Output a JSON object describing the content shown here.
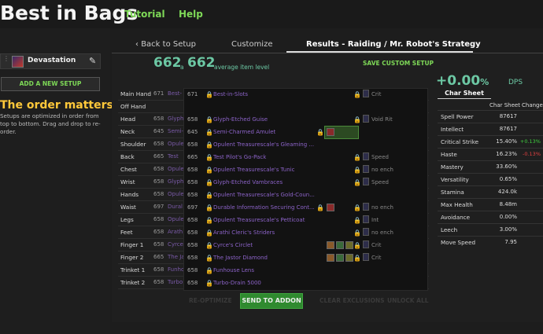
{
  "app": {
    "logo": "Best in Bags",
    "nav": [
      "Tutorial",
      "Help"
    ]
  },
  "sidebar": {
    "setup_name": "Devastation",
    "add_setup": "ADD A NEW SETUP",
    "order_title": "The order matters",
    "order_text": "Setups are optimized in order from top to bottom. Drag and drop to re-order."
  },
  "tabs": {
    "back": "Back to Setup",
    "customize": "Customize",
    "results": "Results - Raiding / Mr. Robot's Strategy"
  },
  "summary": {
    "ilvl_a": "662",
    "ilvl_a_label": "a",
    "ilvl_b": "662",
    "ilvl_b_label": "average item level",
    "save_custom": "SAVE CUSTOM SETUP",
    "dps_change": "+0.00",
    "dps_pct": "%",
    "dps_label": "DPS"
  },
  "char_sheet": {
    "tab": "Char Sheet",
    "col_sheet": "Char Sheet",
    "col_change": "Change",
    "stats": [
      {
        "name": "Spell Power",
        "value": "87617",
        "change": ""
      },
      {
        "name": "Intellect",
        "value": "87617",
        "change": ""
      },
      {
        "name": "Critical Strike",
        "value": "15.40%",
        "change": "+0.13%"
      },
      {
        "name": "Haste",
        "value": "16.23%",
        "change": "-0.13%"
      },
      {
        "name": "Mastery",
        "value": "33.60%",
        "change": ""
      },
      {
        "name": "Versatility",
        "value": "0.65%",
        "change": ""
      },
      {
        "name": "Stamina",
        "value": "424.0k",
        "change": ""
      },
      {
        "name": "Max Health",
        "value": "8.48m",
        "change": ""
      },
      {
        "name": "Avoidance",
        "value": "0.00%",
        "change": ""
      },
      {
        "name": "Leech",
        "value": "3.00%",
        "change": ""
      },
      {
        "name": "Move Speed",
        "value": "7.95",
        "change": ""
      }
    ],
    "colors": {
      "positive": "#3fcf3f",
      "negative": "#e04040"
    }
  },
  "gear": [
    {
      "slot": "Main Hand",
      "ilvl": "671",
      "item": "Best-",
      "ov_ilvl": "671",
      "ov_item": "Best-in-Slots",
      "extra": "Crit"
    },
    {
      "slot": "Off Hand",
      "ilvl": "",
      "item": "",
      "ov_ilvl": "",
      "ov_item": "",
      "extra": ""
    },
    {
      "slot": "Head",
      "ilvl": "658",
      "item": "Glyph",
      "ov_ilvl": "658",
      "ov_item": "Glyph-Etched Guise",
      "extra": "Void Rit"
    },
    {
      "slot": "Neck",
      "ilvl": "645",
      "item": "Semi-",
      "ov_ilvl": "645",
      "ov_item": "Semi-Charmed Amulet",
      "extra": ""
    },
    {
      "slot": "Shoulder",
      "ilvl": "658",
      "item": "Opule",
      "ov_ilvl": "658",
      "ov_item": "Opulent Treasurescale's Gleaming ...",
      "extra": ""
    },
    {
      "slot": "Back",
      "ilvl": "665",
      "item": "Test",
      "ov_ilvl": "665",
      "ov_item": "Test Pilot's Go-Pack",
      "extra": "Speed"
    },
    {
      "slot": "Chest",
      "ilvl": "658",
      "item": "Opule",
      "ov_ilvl": "658",
      "ov_item": "Opulent Treasurescale's Tunic",
      "extra": "no ench"
    },
    {
      "slot": "Wrist",
      "ilvl": "658",
      "item": "Glyph",
      "ov_ilvl": "658",
      "ov_item": "Glyph-Etched Vambraces",
      "extra": "Speed"
    },
    {
      "slot": "Hands",
      "ilvl": "658",
      "item": "Opule",
      "ov_ilvl": "658",
      "ov_item": "Opulent Treasurescale's Gold-Coun...",
      "extra": ""
    },
    {
      "slot": "Waist",
      "ilvl": "697",
      "item": "Dural",
      "ov_ilvl": "697",
      "ov_item": "Durable Information Securing Cont...",
      "extra": "no ench"
    },
    {
      "slot": "Legs",
      "ilvl": "658",
      "item": "Opule",
      "ov_ilvl": "658",
      "ov_item": "Opulent Treasurescale's Petticoat",
      "extra": "Int"
    },
    {
      "slot": "Feet",
      "ilvl": "658",
      "item": "Arath",
      "ov_ilvl": "658",
      "ov_item": "Arathi Cleric's Striders",
      "extra": "no ench"
    },
    {
      "slot": "Finger 1",
      "ilvl": "658",
      "item": "Cyrce",
      "ov_ilvl": "658",
      "ov_item": "Cyrce's Circlet",
      "extra": "Crit"
    },
    {
      "slot": "Finger 2",
      "ilvl": "665",
      "item": "The Ja",
      "ov_ilvl": "658",
      "ov_item": "The Jastor Diamond",
      "extra": "Crit"
    },
    {
      "slot": "Trinket 1",
      "ilvl": "658",
      "item": "Funho",
      "ov_ilvl": "658",
      "ov_item": "Funhouse Lens",
      "extra": ""
    },
    {
      "slot": "Trinket 2",
      "ilvl": "658",
      "item": "Turbo",
      "ov_ilvl": "658",
      "ov_item": "Turbo-Drain 5000",
      "extra": ""
    }
  ],
  "actions": {
    "reoptimize": "RE-OPTIMIZE",
    "send": "SEND TO ADDON",
    "clear": "CLEAR EXCLUSIONS",
    "unlock": "UNLOCK ALL"
  }
}
